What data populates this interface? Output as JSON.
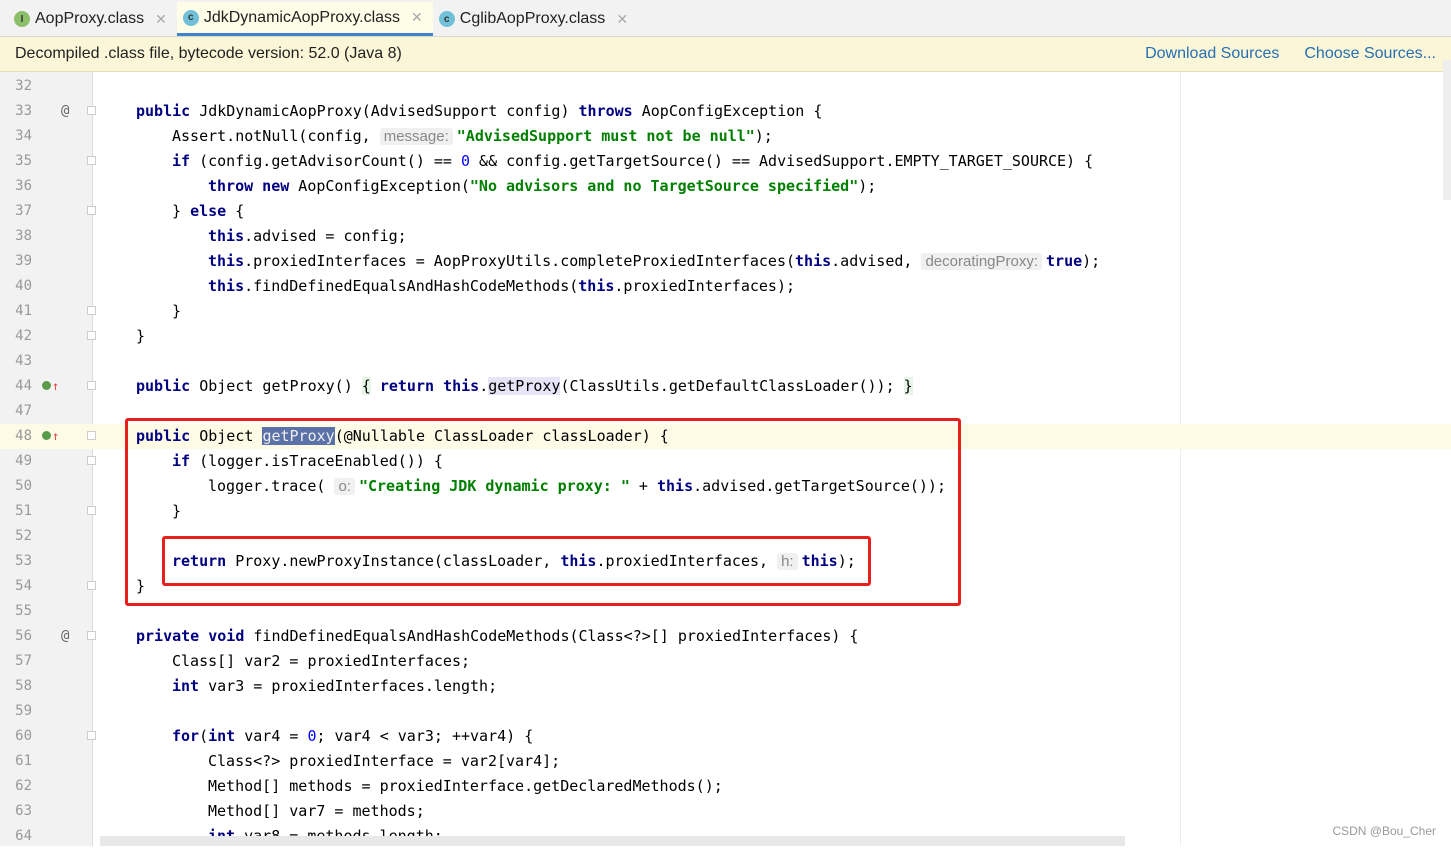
{
  "tabs": [
    {
      "label": "AopProxy.class",
      "icon": "interface-icon",
      "icon_letter": "I",
      "color": "#8bbf6a",
      "active": false
    },
    {
      "label": "JdkDynamicAopProxy.class",
      "icon": "class-icon",
      "icon_letter": "c",
      "color": "#6fc0d8",
      "active": true
    },
    {
      "label": "CglibAopProxy.class",
      "icon": "class-icon",
      "icon_letter": "c",
      "color": "#6fc0d8",
      "active": false
    }
  ],
  "banner": {
    "text": "Decompiled .class file, bytecode version: 52.0 (Java 8)",
    "download": "Download Sources",
    "choose": "Choose Sources..."
  },
  "watermark": "CSDN @Bou_Cher",
  "lines": [
    {
      "n": "32",
      "i": 0,
      "t": []
    },
    {
      "n": "33",
      "i": 1,
      "g": "at",
      "t": [
        [
          "public",
          "kw"
        ],
        " JdkDynamicAopProxy(AdvisedSupport config) ",
        [
          "throws",
          "kw"
        ],
        " AopConfigException {"
      ]
    },
    {
      "n": "34",
      "i": 2,
      "t": [
        "Assert.notNull(config, ",
        [
          "message:",
          "hint"
        ],
        [
          "\"AdvisedSupport must not be null\"",
          "str"
        ],
        ");"
      ]
    },
    {
      "n": "35",
      "i": 2,
      "t": [
        [
          "if",
          "kw"
        ],
        " (config.getAdvisorCount() == ",
        [
          "0",
          "n"
        ],
        " && config.getTargetSource() == AdvisedSupport.EMPTY_TARGET_SOURCE) {"
      ]
    },
    {
      "n": "36",
      "i": 3,
      "t": [
        [
          "throw new",
          "kw"
        ],
        " AopConfigException(",
        [
          "\"No advisors and no TargetSource specified\"",
          "str"
        ],
        ");"
      ]
    },
    {
      "n": "37",
      "i": 2,
      "t": [
        "} ",
        [
          "else",
          "kw"
        ],
        " {"
      ]
    },
    {
      "n": "38",
      "i": 3,
      "t": [
        [
          "this",
          "kw"
        ],
        ".advised = config;"
      ]
    },
    {
      "n": "39",
      "i": 3,
      "t": [
        [
          "this",
          "kw"
        ],
        ".proxiedInterfaces = AopProxyUtils.completeProxiedInterfaces(",
        [
          "this",
          "kw"
        ],
        ".advised, ",
        [
          "decoratingProxy:",
          "hint"
        ],
        [
          "true",
          "kw"
        ],
        ");"
      ]
    },
    {
      "n": "40",
      "i": 3,
      "t": [
        [
          "this",
          "kw"
        ],
        ".findDefinedEqualsAndHashCodeMethods(",
        [
          "this",
          "kw"
        ],
        ".proxiedInterfaces);"
      ]
    },
    {
      "n": "41",
      "i": 2,
      "t": [
        "}"
      ]
    },
    {
      "n": "42",
      "i": 1,
      "t": [
        "}"
      ]
    },
    {
      "n": "43",
      "i": 0,
      "t": []
    },
    {
      "n": "44",
      "i": 1,
      "g": "ov",
      "t": [
        [
          "public",
          "kw"
        ],
        " Object getProxy() ",
        [
          "{",
          "brace"
        ],
        " ",
        [
          "return",
          "kw"
        ],
        " ",
        [
          "this",
          "kw"
        ],
        ".",
        [
          "getProxy",
          "use"
        ],
        "(ClassUtils.getDefaultClassLoader()); ",
        [
          "}",
          "brace"
        ]
      ]
    },
    {
      "n": "47",
      "i": 0,
      "t": []
    },
    {
      "n": "48",
      "i": 1,
      "g": "ov",
      "cur": true,
      "t": [
        [
          "public",
          "kw"
        ],
        " Object ",
        [
          "getProxy",
          "sel"
        ],
        "(@Nullable ClassLoader classLoader) {"
      ]
    },
    {
      "n": "49",
      "i": 2,
      "t": [
        [
          "if",
          "kw"
        ],
        " (logger.isTraceEnabled()) {"
      ]
    },
    {
      "n": "50",
      "i": 3,
      "t": [
        "logger.trace( ",
        [
          "o:",
          "hint"
        ],
        [
          "\"Creating JDK dynamic proxy: \"",
          "str"
        ],
        " + ",
        [
          "this",
          "kw"
        ],
        ".advised.getTargetSource());"
      ]
    },
    {
      "n": "51",
      "i": 2,
      "t": [
        "}"
      ]
    },
    {
      "n": "52",
      "i": 0,
      "t": []
    },
    {
      "n": "53",
      "i": 2,
      "t": [
        [
          "return",
          "kw"
        ],
        " Proxy.newProxyInstance(classLoader, ",
        [
          "this",
          "kw"
        ],
        ".proxiedInterfaces, ",
        [
          "h:",
          "hint"
        ],
        [
          "this",
          "kw"
        ],
        ");"
      ]
    },
    {
      "n": "54",
      "i": 1,
      "t": [
        "}"
      ]
    },
    {
      "n": "55",
      "i": 0,
      "t": []
    },
    {
      "n": "56",
      "i": 1,
      "g": "at",
      "t": [
        [
          "private void",
          "kw"
        ],
        " findDefinedEqualsAndHashCodeMethods(Class<?>[] proxiedInterfaces) {"
      ]
    },
    {
      "n": "57",
      "i": 2,
      "t": [
        "Class[] var2 = proxiedInterfaces;"
      ]
    },
    {
      "n": "58",
      "i": 2,
      "t": [
        [
          "int",
          "kw"
        ],
        " var3 = proxiedInterfaces.length;"
      ]
    },
    {
      "n": "59",
      "i": 0,
      "t": []
    },
    {
      "n": "60",
      "i": 2,
      "t": [
        [
          "for",
          "kw"
        ],
        "(",
        [
          "int",
          "kw"
        ],
        " var4 = ",
        [
          "0",
          "n"
        ],
        "; var4 < var3; ++var4) {"
      ]
    },
    {
      "n": "61",
      "i": 3,
      "t": [
        "Class<?> proxiedInterface = var2[var4];"
      ]
    },
    {
      "n": "62",
      "i": 3,
      "t": [
        "Method[] methods = proxiedInterface.getDeclaredMethods();"
      ]
    },
    {
      "n": "63",
      "i": 3,
      "t": [
        "Method[] var7 = methods;"
      ]
    },
    {
      "n": "64",
      "i": 3,
      "t": [
        [
          "int",
          "kw"
        ],
        " var8 = methods.length;"
      ]
    }
  ]
}
